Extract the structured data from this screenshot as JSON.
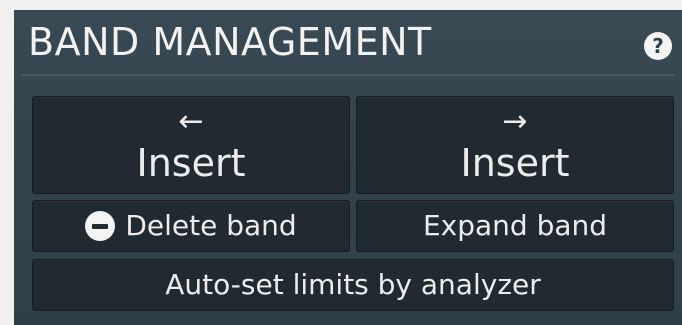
{
  "header": {
    "title": "BAND MANAGEMENT",
    "help_icon": "?"
  },
  "buttons": {
    "insert_left": {
      "arrow": "←",
      "label": "Insert",
      "icon": "arrow-left-icon"
    },
    "insert_right": {
      "arrow": "→",
      "label": "Insert",
      "icon": "arrow-right-icon"
    },
    "delete_band": {
      "label": "Delete band",
      "icon": "minus-circle-icon"
    },
    "expand_band": {
      "label": "Expand band"
    },
    "auto_set": {
      "label": "Auto-set limits by analyzer"
    }
  },
  "colors": {
    "panel_background": "#34444e",
    "button_background": "#202a30",
    "text": "#ececec"
  }
}
